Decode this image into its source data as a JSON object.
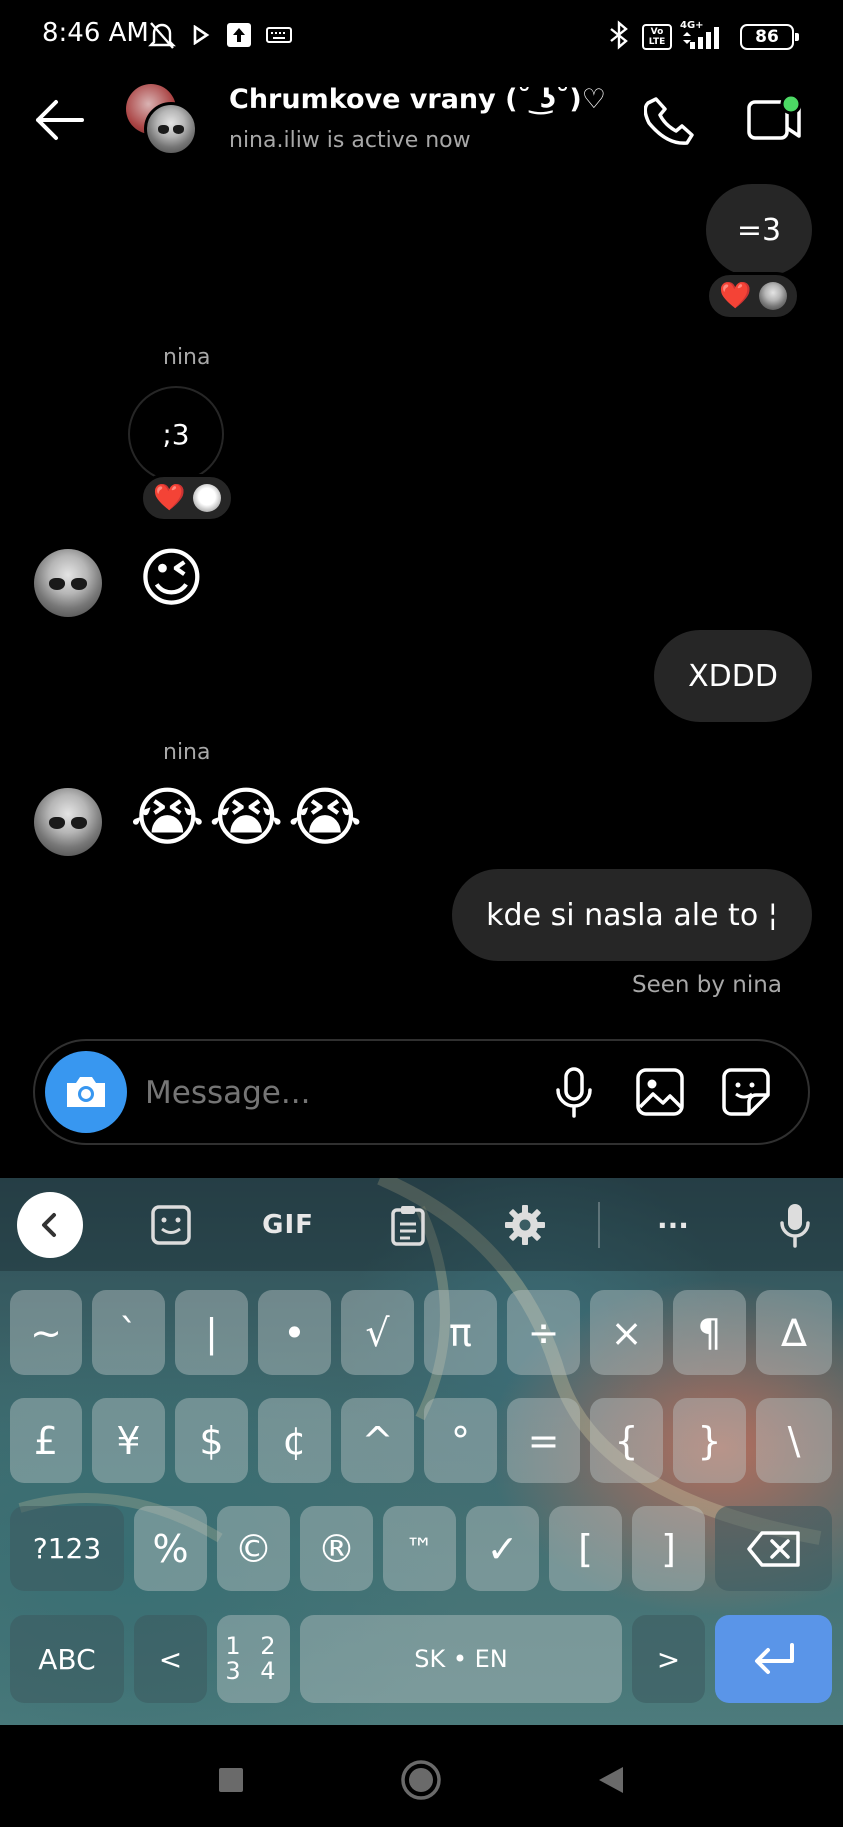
{
  "status_bar": {
    "time": "8:46 AM",
    "battery": "86",
    "network": "4G+",
    "volte": "Vo LTE"
  },
  "header": {
    "title": "Chrumkove vrany (˘ ͜ʖ˘)♡",
    "subtitle": "nina.iliw is active now"
  },
  "messages": {
    "m1": {
      "text": "=3",
      "reaction": "❤️"
    },
    "m2": {
      "sender": "nina",
      "text": ";3",
      "reaction": "❤️"
    },
    "m3": {
      "emoji": "😉"
    },
    "m4": {
      "text": "XDDD"
    },
    "m5": {
      "sender": "nina",
      "emoji": "😭😭😭"
    },
    "m6": {
      "text": "kde si nasla ale to ¦"
    },
    "seen": "Seen by nina"
  },
  "composer": {
    "placeholder": "Message..."
  },
  "keyboard": {
    "toolbar": {
      "gif": "GIF",
      "more": "···"
    },
    "row1": [
      "~",
      "`",
      "|",
      "•",
      "√",
      "π",
      "÷",
      "×",
      "¶",
      "∆"
    ],
    "row2": [
      "£",
      "¥",
      "$",
      "¢",
      "^",
      "°",
      "=",
      "{",
      "}",
      "\\"
    ],
    "row3": {
      "mode": "?123",
      "keys": [
        "%",
        "©",
        "®",
        "™",
        "✓",
        "[",
        "]"
      ]
    },
    "row4": {
      "abc": "ABC",
      "lt": "<",
      "numpad_top": "1 2",
      "numpad_bottom": "3 4",
      "space": "SK • EN",
      "gt": ">"
    }
  },
  "colors": {
    "accent": "#3897f0",
    "bubble": "#262626",
    "enter": "#5a95e8",
    "active_dot": "#4cd964"
  }
}
